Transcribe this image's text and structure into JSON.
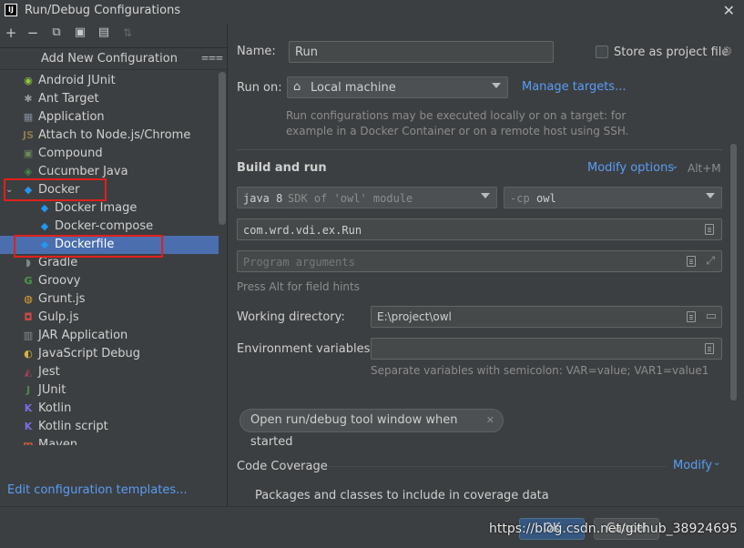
{
  "window": {
    "title": "Run/Debug Configurations",
    "app_icon_text": "IJ"
  },
  "toolbar": {
    "icons": [
      "add-icon",
      "remove-icon",
      "copy-icon",
      "save-icon",
      "folder-add-icon",
      "sort-icon"
    ]
  },
  "tree": {
    "header": "Add New Configuration",
    "items": [
      {
        "label": "Android JUnit",
        "icon": "android-icon",
        "color": "#8ec63f"
      },
      {
        "label": "Ant Target",
        "icon": "ant-icon",
        "color": "#9a9a9a"
      },
      {
        "label": "Application",
        "icon": "application-icon",
        "color": "#7f8c9a"
      },
      {
        "label": "Attach to Node.js/Chrome",
        "icon": "nodejs-icon",
        "color": "#8a7a4a"
      },
      {
        "label": "Compound",
        "icon": "compound-icon",
        "color": "#6a8a5a"
      },
      {
        "label": "Cucumber Java",
        "icon": "cucumber-icon",
        "color": "#4a8a4a"
      },
      {
        "label": "Docker",
        "icon": "docker-icon",
        "color": "#2496ed",
        "expanded": true
      },
      {
        "label": "Docker Image",
        "icon": "docker-icon",
        "color": "#2496ed",
        "child": true
      },
      {
        "label": "Docker-compose",
        "icon": "docker-icon",
        "color": "#2496ed",
        "child": true
      },
      {
        "label": "Dockerfile",
        "icon": "docker-icon",
        "color": "#2496ed",
        "child": true,
        "selected": true
      },
      {
        "label": "Gradle",
        "icon": "gradle-icon",
        "color": "#7a8a8a"
      },
      {
        "label": "Groovy",
        "icon": "groovy-icon",
        "color": "#4a9a4a"
      },
      {
        "label": "Grunt.js",
        "icon": "grunt-icon",
        "color": "#e2a236"
      },
      {
        "label": "Gulp.js",
        "icon": "gulp-icon",
        "color": "#cf4647"
      },
      {
        "label": "JAR Application",
        "icon": "jar-icon",
        "color": "#8a8a8a"
      },
      {
        "label": "JavaScript Debug",
        "icon": "js-debug-icon",
        "color": "#d6b43a"
      },
      {
        "label": "Jest",
        "icon": "jest-icon",
        "color": "#99425b"
      },
      {
        "label": "JUnit",
        "icon": "junit-icon",
        "color": "#4a8a4a"
      },
      {
        "label": "Kotlin",
        "icon": "kotlin-icon",
        "color": "#7f6ae8"
      },
      {
        "label": "Kotlin script",
        "icon": "kotlin-script-icon",
        "color": "#7f6ae8"
      },
      {
        "label": "Maven",
        "icon": "maven-icon",
        "color": "#c25a3a"
      }
    ],
    "edit_templates": "Edit configuration templates..."
  },
  "form": {
    "name_label": "Name:",
    "name_value": "Run",
    "store_label": "Store as project file",
    "run_on_label": "Run on:",
    "run_on_value": "Local machine",
    "manage_targets": "Manage targets...",
    "run_on_hint_1": "Run configurations may be executed locally or on a target: for",
    "run_on_hint_2": "example in a Docker Container or on a remote host using SSH.",
    "build_and_run": "Build and run",
    "modify_options": "Modify options",
    "modify_shortcut": "Alt+M",
    "jdk_value": "java 8",
    "jdk_hint": "SDK of 'owl' module",
    "cp_prefix": "-cp",
    "cp_value": "owl",
    "main_class": "com.wrd.vdi.ex.Run",
    "program_args_placeholder": "Program arguments",
    "field_hints": "Press Alt for field hints",
    "working_dir_label": "Working directory:",
    "working_dir_value": "E:\\project\\owl",
    "env_label": "Environment variables:",
    "env_hint": "Separate variables with semicolon: VAR=value; VAR1=value1",
    "open_tool_window": "Open run/debug tool window when started",
    "code_coverage": "Code Coverage",
    "modify": "Modify",
    "packages_label": "Packages and classes to include in coverage data"
  },
  "footer": {
    "help": "?",
    "ok": "OK",
    "cancel": "Cancel",
    "watermark": "https://blog.csdn.net/github_38924695"
  }
}
